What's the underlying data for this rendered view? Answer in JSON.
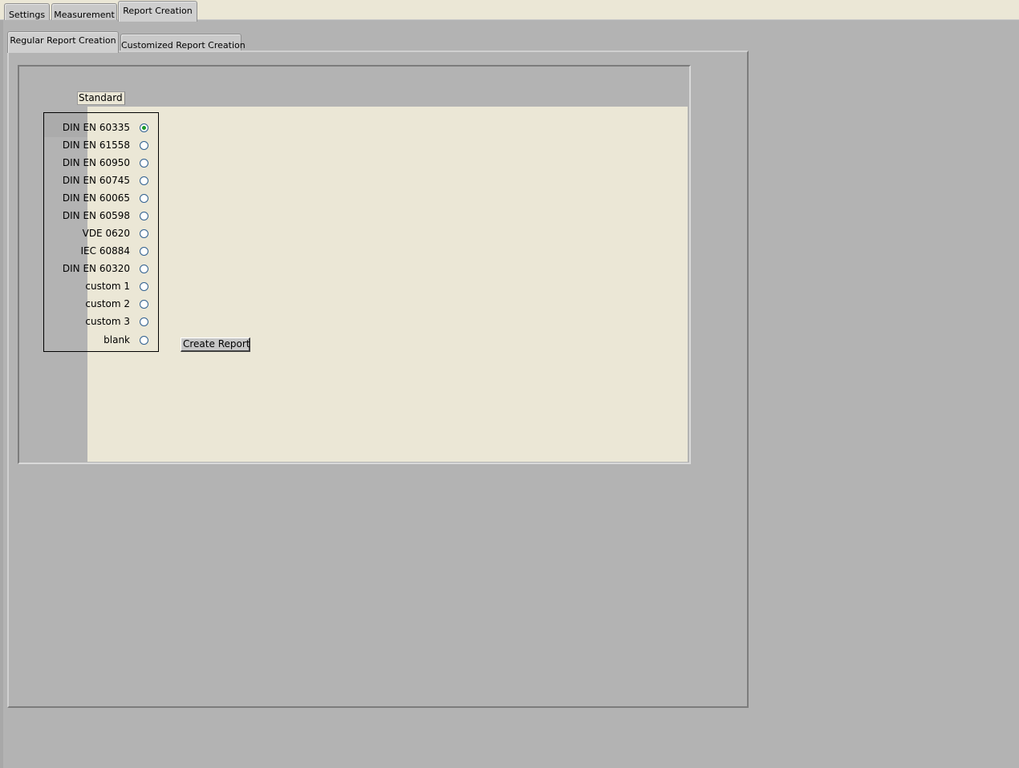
{
  "main_tabs": [
    {
      "label": "Settings",
      "active": false
    },
    {
      "label": "Measurement",
      "active": false
    },
    {
      "label": "Report Creation",
      "active": true
    }
  ],
  "sub_tabs": [
    {
      "label": "Regular Report Creation",
      "active": true
    },
    {
      "label": "Customized Report Creation",
      "active": false
    }
  ],
  "standard": {
    "label": "Standard",
    "selected_index": 0,
    "options": [
      "DIN EN 60335",
      "DIN EN 61558",
      "DIN EN 60950",
      "DIN EN 60745",
      "DIN EN 60065",
      "DIN EN 60598",
      "VDE 0620",
      "IEC 60884",
      "DIN EN 60320",
      "custom 1",
      "custom 2",
      "custom 3",
      "blank"
    ]
  },
  "actions": {
    "create_report_label": "Create Report"
  },
  "colors": {
    "panel_gray": "#b3b3b3",
    "cream": "#ebe7d6",
    "radio_selected": "#1a9a2a"
  }
}
